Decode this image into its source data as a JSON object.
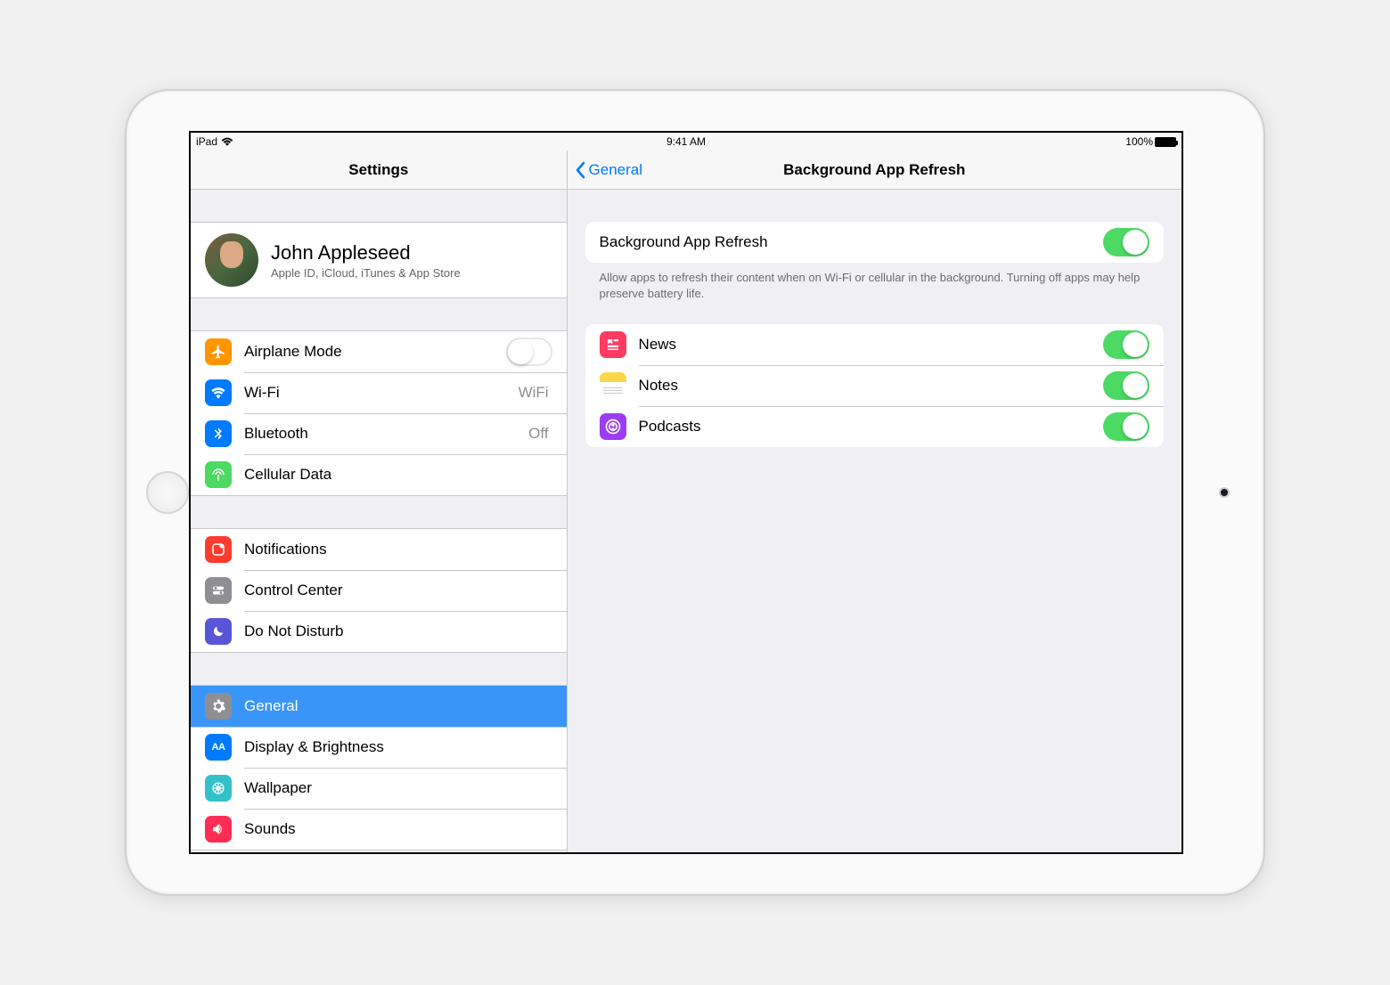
{
  "statusBar": {
    "device": "iPad",
    "time": "9:41 AM",
    "batteryPct": "100%"
  },
  "sidebar": {
    "title": "Settings",
    "profile": {
      "name": "John Appleseed",
      "subtitle": "Apple ID, iCloud, iTunes & App Store"
    },
    "group1": {
      "airplane": {
        "label": "Airplane Mode",
        "on": false
      },
      "wifi": {
        "label": "Wi-Fi",
        "value": "WiFi"
      },
      "bluetooth": {
        "label": "Bluetooth",
        "value": "Off"
      },
      "cellular": {
        "label": "Cellular Data"
      }
    },
    "group2": {
      "notifications": {
        "label": "Notifications"
      },
      "controlCenter": {
        "label": "Control Center"
      },
      "dnd": {
        "label": "Do Not Disturb"
      }
    },
    "group3": {
      "general": {
        "label": "General"
      },
      "display": {
        "label": "Display & Brightness"
      },
      "wallpaper": {
        "label": "Wallpaper"
      },
      "sounds": {
        "label": "Sounds"
      }
    }
  },
  "detail": {
    "backLabel": "General",
    "title": "Background App Refresh",
    "masterToggle": {
      "label": "Background App Refresh",
      "on": true
    },
    "footer": "Allow apps to refresh their content when on Wi-Fi or cellular in the background. Turning off apps may help preserve battery life.",
    "apps": [
      {
        "name": "News",
        "on": true,
        "iconColor": "#ff3b63",
        "glyph": "news"
      },
      {
        "name": "Notes",
        "on": true,
        "iconColor": "#ffd54a",
        "glyph": "notes"
      },
      {
        "name": "Podcasts",
        "on": true,
        "iconColor": "#9c3df5",
        "glyph": "podcasts"
      }
    ]
  },
  "icons": {
    "airplaneColor": "#ff9500",
    "wifiColor": "#007aff",
    "bluetoothColor": "#007aff",
    "cellularColor": "#4cd964",
    "notificationsColor": "#ff3b30",
    "controlCenterColor": "#8e8e93",
    "dndColor": "#5856d6",
    "generalColor": "#8e8e93",
    "displayColor": "#007aff",
    "wallpaperColor": "#33c1c9",
    "soundsColor": "#ff2d55"
  }
}
